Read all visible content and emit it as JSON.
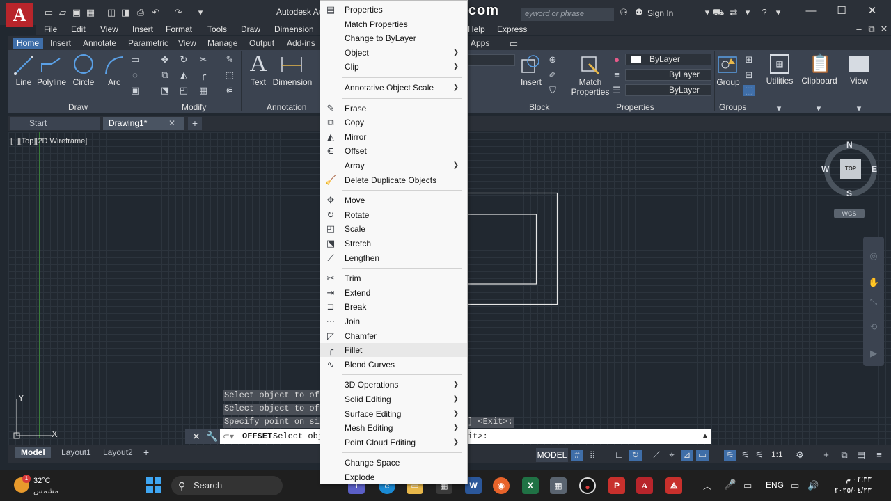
{
  "app": {
    "title": "Autodesk Au",
    "logo_letter": "A"
  },
  "watermark": "www.BANDICAM.com",
  "search": {
    "placeholder": "eyword or phrase"
  },
  "account": {
    "sign_in": "Sign In"
  },
  "window_controls": [
    "—",
    "☐",
    "✕"
  ],
  "menu": [
    "File",
    "Edit",
    "View",
    "Insert",
    "Format",
    "Tools",
    "Draw",
    "Dimension",
    "Help",
    "Express"
  ],
  "ribbon_tabs": [
    {
      "label": "Home",
      "active": true
    },
    {
      "label": "Insert"
    },
    {
      "label": "Annotate"
    },
    {
      "label": "Parametric"
    },
    {
      "label": "View"
    },
    {
      "label": "Manage"
    },
    {
      "label": "Output"
    },
    {
      "label": "Add-ins"
    },
    {
      "label": "Apps"
    }
  ],
  "ribbon": {
    "draw_tools": [
      "Line",
      "Polyline",
      "Circle",
      "Arc"
    ],
    "annotation_tools": [
      "Text",
      "Dimension"
    ],
    "block_tools": [
      "Insert"
    ],
    "properties_tools": [
      "Match",
      "Properties"
    ],
    "groups_tools": [
      "Group"
    ],
    "misc_tools": [
      "Utilities",
      "Clipboard",
      "View"
    ],
    "panels": [
      "Draw",
      "Modify",
      "Annotation",
      "Block",
      "Properties",
      "Groups"
    ],
    "properties_values": [
      "ByLayer",
      "ByLayer",
      "ByLayer"
    ]
  },
  "file_tabs": [
    {
      "label": "Start"
    },
    {
      "label": "Drawing1*",
      "active": true
    }
  ],
  "viewport_label": "[−][Top][2D Wireframe]",
  "command": {
    "history": [
      "Select object to offs",
      "Select object to offs",
      "Specify point on side"
    ],
    "history_tail": "] <Exit>:",
    "current_cmd": "OFFSET",
    "current_text": "Select obj",
    "current_tail": "it>:"
  },
  "layout_tabs": [
    {
      "label": "Model",
      "active": true
    },
    {
      "label": "Layout1"
    },
    {
      "label": "Layout2"
    }
  ],
  "status": {
    "model": "MODEL",
    "scale": "1:1"
  },
  "viewcube": {
    "n": "N",
    "s": "S",
    "e": "E",
    "w": "W",
    "top": "TOP",
    "wcs": "WCS"
  },
  "taskbar": {
    "temp": "32°C",
    "weather_text": "مشمس",
    "badge": "1",
    "search": "Search",
    "lang": "ENG",
    "time": "٠٢:٣٣ م",
    "date": "٢٠٢٥/٠٤/٢٣"
  },
  "context_menu": [
    {
      "label": "Properties",
      "icon": "properties-icon",
      "glyph": "▤"
    },
    {
      "label": "Match Properties",
      "icon": "match-properties-icon",
      "glyph": ""
    },
    {
      "label": "Change to ByLayer",
      "icon": "bylayer-icon",
      "glyph": ""
    },
    {
      "label": "Object",
      "submenu": true
    },
    {
      "label": "Clip",
      "submenu": true
    },
    {
      "sep": true
    },
    {
      "label": "Annotative Object Scale",
      "submenu": true
    },
    {
      "sep": true
    },
    {
      "label": "Erase",
      "icon": "erase-icon",
      "glyph": "✎"
    },
    {
      "label": "Copy",
      "icon": "copy-icon",
      "glyph": "⧉"
    },
    {
      "label": "Mirror",
      "icon": "mirror-icon",
      "glyph": "◭"
    },
    {
      "label": "Offset",
      "icon": "offset-icon",
      "glyph": "⋐"
    },
    {
      "label": "Array",
      "submenu": true
    },
    {
      "label": "Delete Duplicate Objects",
      "icon": "delete-duplicates-icon",
      "glyph": "🧹"
    },
    {
      "sep": true
    },
    {
      "label": "Move",
      "icon": "move-icon",
      "glyph": "✥"
    },
    {
      "label": "Rotate",
      "icon": "rotate-icon",
      "glyph": "↻"
    },
    {
      "label": "Scale",
      "icon": "scale-icon",
      "glyph": "◰"
    },
    {
      "label": "Stretch",
      "icon": "stretch-icon",
      "glyph": "⬔"
    },
    {
      "label": "Lengthen",
      "icon": "lengthen-icon",
      "glyph": "⟋"
    },
    {
      "sep": true
    },
    {
      "label": "Trim",
      "icon": "trim-icon",
      "glyph": "✂"
    },
    {
      "label": "Extend",
      "icon": "extend-icon",
      "glyph": "⇥"
    },
    {
      "label": "Break",
      "icon": "break-icon",
      "glyph": "⊐"
    },
    {
      "label": "Join",
      "icon": "join-icon",
      "glyph": "⋯"
    },
    {
      "label": "Chamfer",
      "icon": "chamfer-icon",
      "glyph": "◸"
    },
    {
      "label": "Fillet",
      "icon": "fillet-icon",
      "glyph": "╭",
      "highlight": true
    },
    {
      "label": "Blend Curves",
      "icon": "blend-curves-icon",
      "glyph": "∿"
    },
    {
      "sep": true
    },
    {
      "label": "3D Operations",
      "submenu": true
    },
    {
      "label": "Solid Editing",
      "submenu": true
    },
    {
      "label": "Surface Editing",
      "submenu": true
    },
    {
      "label": "Mesh Editing",
      "submenu": true
    },
    {
      "label": "Point Cloud Editing",
      "submenu": true
    },
    {
      "sep": true
    },
    {
      "label": "Change Space"
    },
    {
      "label": "Explode"
    }
  ]
}
